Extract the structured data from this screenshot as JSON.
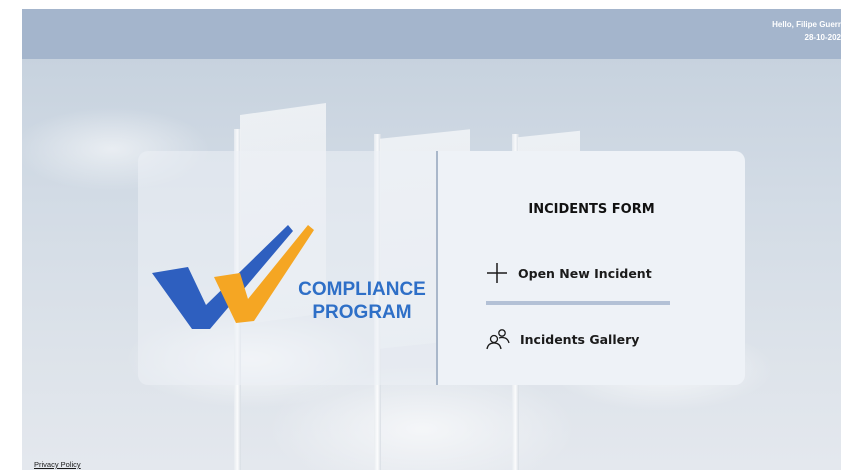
{
  "header": {
    "greeting": "Hello, Filipe Guerr",
    "date": "28-10-202"
  },
  "logo": {
    "line1": "COMPLIANCE",
    "line2": "PROGRAM",
    "colors": {
      "blue": "#2e5fbf",
      "orange": "#f5a623",
      "text": "#2e6fc7"
    }
  },
  "form": {
    "title": "INCIDENTS FORM",
    "actions": [
      {
        "label": "Open New Incident",
        "icon": "plus-icon"
      },
      {
        "label": "Incidents Gallery",
        "icon": "people-icon"
      }
    ]
  },
  "footer": {
    "privacy": "Privacy Policy"
  },
  "theme": {
    "header_bg": "#a4b5cc",
    "card_right_bg": "#eef2f7",
    "accent": "#b3c1d6"
  }
}
